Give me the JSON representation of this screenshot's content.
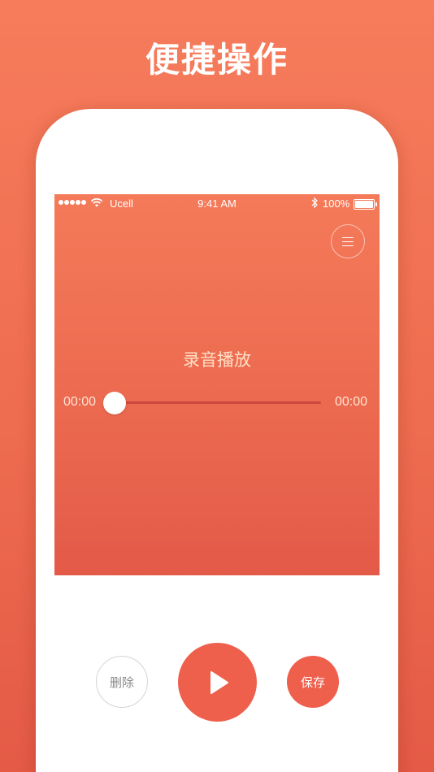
{
  "headline": "便捷操作",
  "status_bar": {
    "carrier": "Ucell",
    "time": "9:41 AM",
    "battery": "100%"
  },
  "player": {
    "title": "录音播放",
    "current_time": "00:00",
    "total_time": "00:00",
    "progress": 0
  },
  "controls": {
    "delete_label": "删除",
    "play_icon": "play-icon",
    "save_label": "保存"
  },
  "colors": {
    "accent": "#ee5f4c",
    "background_top": "#f67c5c",
    "background_bottom": "#e45a46",
    "title_text": "#ffe0c6"
  }
}
